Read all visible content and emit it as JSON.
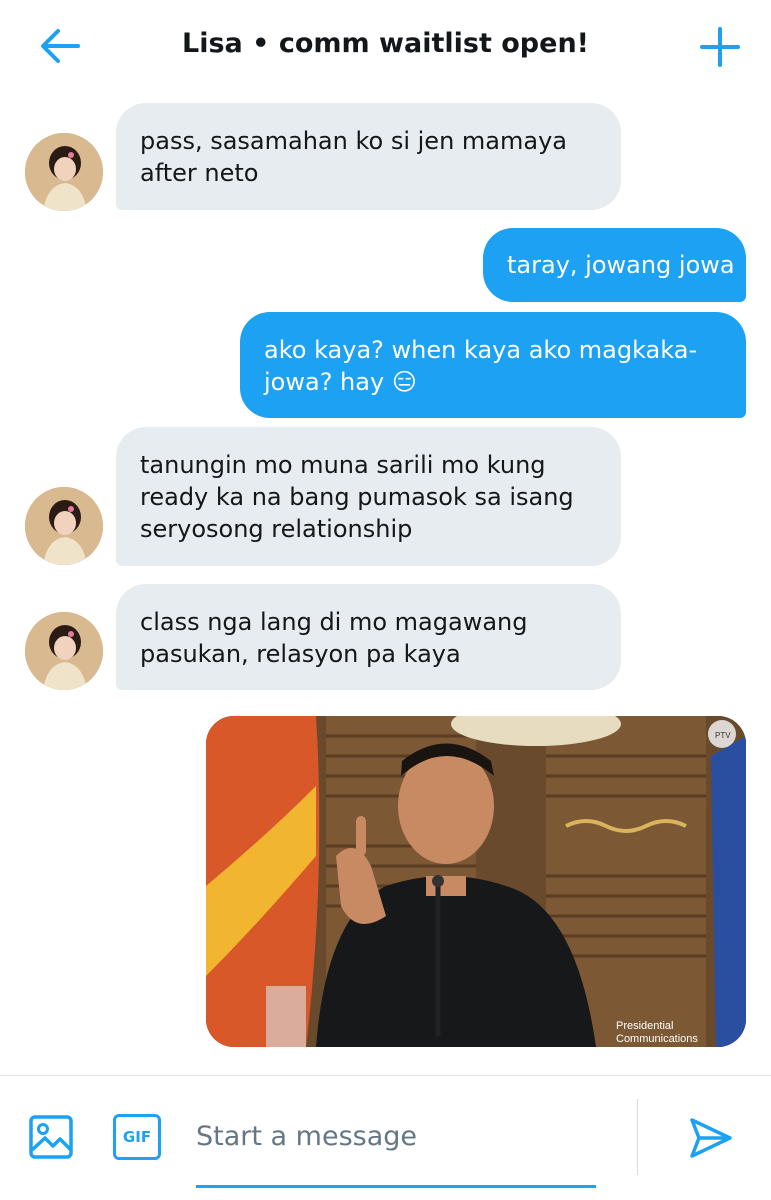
{
  "header": {
    "title": "Lisa • comm waitlist open!",
    "back_icon": "arrow-left-icon",
    "new_icon": "plus-icon",
    "accent": "#1da1f2"
  },
  "messages": [
    {
      "side": "in",
      "lines": [
        "pass, sasamahan ko si jen mamaya",
        "after neto"
      ]
    },
    {
      "side": "out",
      "lines": [
        "taray, jowang jowa"
      ]
    },
    {
      "side": "out",
      "lines": [
        "ako kaya? when kaya ako magkaka-",
        "jowa? hay"
      ],
      "emoji": "😑"
    },
    {
      "side": "in",
      "lines": [
        "tanungin mo muna sarili mo kung",
        "ready ka na bang pumasok sa isang",
        "seryosong relationship"
      ]
    },
    {
      "side": "in",
      "lines": [
        "class nga lang di mo magawang",
        "pasukan, relasyon pa kaya"
      ]
    },
    {
      "side": "out",
      "type": "image",
      "alt_icon": "photo-meme",
      "watermark": [
        "Presidential",
        "Communications"
      ],
      "logo_text": "PTV"
    }
  ],
  "colors": {
    "incoming_bubble": "#e6ecf0",
    "outgoing_bubble": "#1da1f2"
  },
  "composer": {
    "placeholder": "Start a message",
    "gif_label": "GIF",
    "image_icon": "image-icon",
    "send_icon": "send-icon"
  }
}
